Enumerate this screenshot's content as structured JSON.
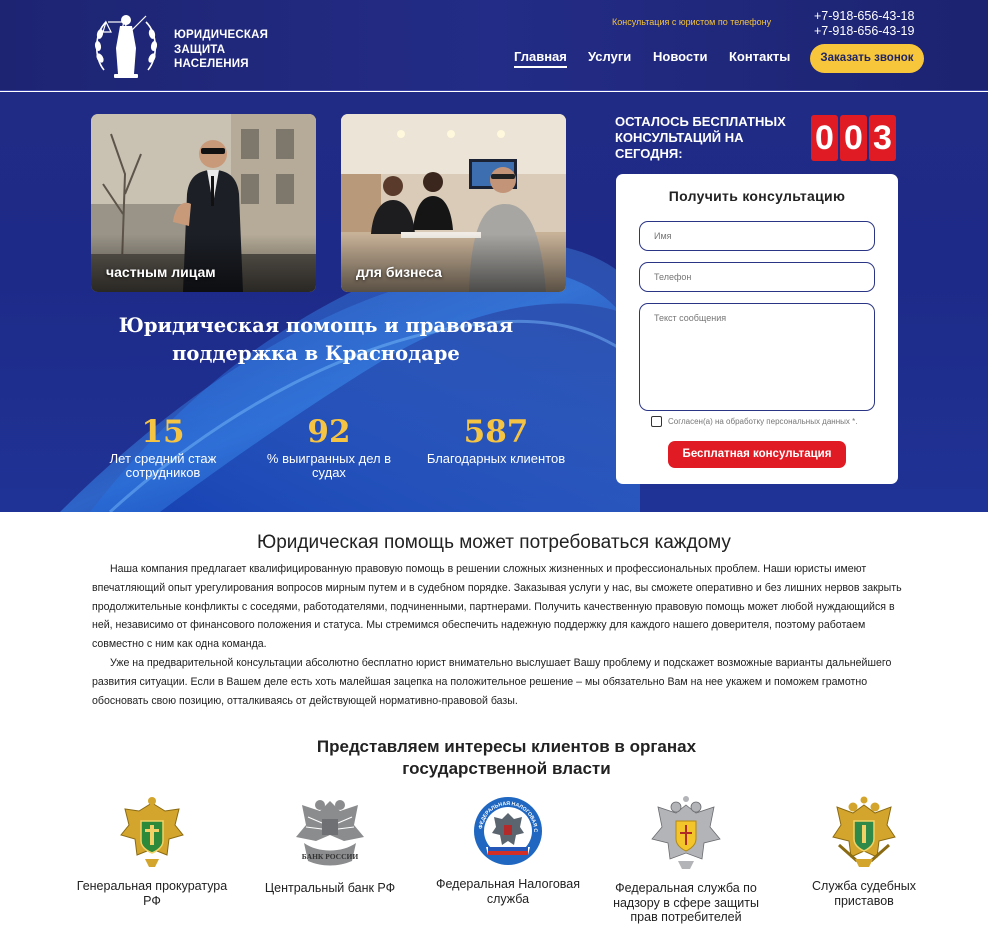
{
  "header": {
    "logo_text": "ЮРИДИЧЕСКАЯ ЗАЩИТА НАСЕЛЕНИЯ",
    "consult_label": "Консультация с юристом по телефону",
    "phones": [
      "+7-918-656-43-18",
      "+7-918-656-43-19"
    ],
    "nav": [
      "Главная",
      "Услуги",
      "Новости",
      "Контакты"
    ],
    "callback_label": "Заказать звонок"
  },
  "hero": {
    "cards": [
      "частным лицам",
      "для бизнеса"
    ],
    "title": "Юридическая помощь и правовая поддержка в Краснодаре",
    "stats": [
      {
        "value": "15",
        "label": "Лет средний стаж сотрудников"
      },
      {
        "value": "92",
        "label": "% выигранных дел в судах"
      },
      {
        "value": "587",
        "label": "Благодарных клиентов"
      }
    ],
    "remain_label": "ОСТАЛОСЬ БЕСПЛАТНЫХ КОНСУЛЬТАЦИЙ НА СЕГОДНЯ:",
    "counter_digits": [
      "0",
      "0",
      "3"
    ]
  },
  "form": {
    "title": "Получить консультацию",
    "name_placeholder": "Имя",
    "phone_placeholder": "Телефон",
    "message_placeholder": "Текст сообщения",
    "consent": "Согласен(а) на обработку персональных данных *.",
    "submit": "Бесплатная консультация"
  },
  "about": {
    "title": "Юридическая помощь может потребоваться каждому",
    "paragraphs": [
      "Наша компания предлагает квалифицированную правовую помощь в решении сложных жизненных и профессиональных проблем. Наши юристы имеют впечатляющий опыт урегулирования вопросов мирным путем и в судебном порядке. Заказывая услуги у нас, вы сможете оперативно и без лишних нервов закрыть продолжительные конфликты с соседями, работодателями, подчиненными, партнерами. Получить качественную правовую помощь может любой нуждающийся в ней, независимо от финансового положения и статуса. Мы стремимся обеспечить надежную поддержку для каждого нашего доверителя, поэтому работаем совместно с ним как одна команда.",
      "Уже на предварительной консультации абсолютно бесплатно юрист внимательно выслушает Вашу проблему и подскажет возможные варианты дальнейшего развития ситуации. Если в Вашем деле есть хоть малейшая зацепка на положительное решение – мы обязательно Вам на нее укажем и поможем грамотно обосновать свою позицию, отталкиваясь от действующей нормативно-правовой базы."
    ]
  },
  "representation": {
    "title": "Представляем интересы клиентов в органах государственной власти",
    "orgs": [
      {
        "name": "Генеральная прокуратура РФ",
        "icon": "prosecutor-emblem-icon"
      },
      {
        "name": "Центральный банк РФ",
        "icon": "bank-of-russia-emblem-icon",
        "emblem_text": "БАНК РОССИИ"
      },
      {
        "name": "Федеральная Налоговая служба",
        "icon": "tax-service-emblem-icon",
        "emblem_text": "ФЕДЕРАЛЬНАЯ НАЛОГОВАЯ СЛУЖБА"
      },
      {
        "name": "Федеральная служба по надзору в сфере защиты прав потребителей",
        "icon": "rospotrebnadzor-emblem-icon"
      },
      {
        "name": "Служба судебных приставов",
        "icon": "bailiffs-emblem-icon"
      }
    ]
  },
  "colors": {
    "header_bg": "#1d2472",
    "accent_yellow": "#f7c63b",
    "accent_red": "#e01b24",
    "stat_gold": "#f6c443"
  }
}
